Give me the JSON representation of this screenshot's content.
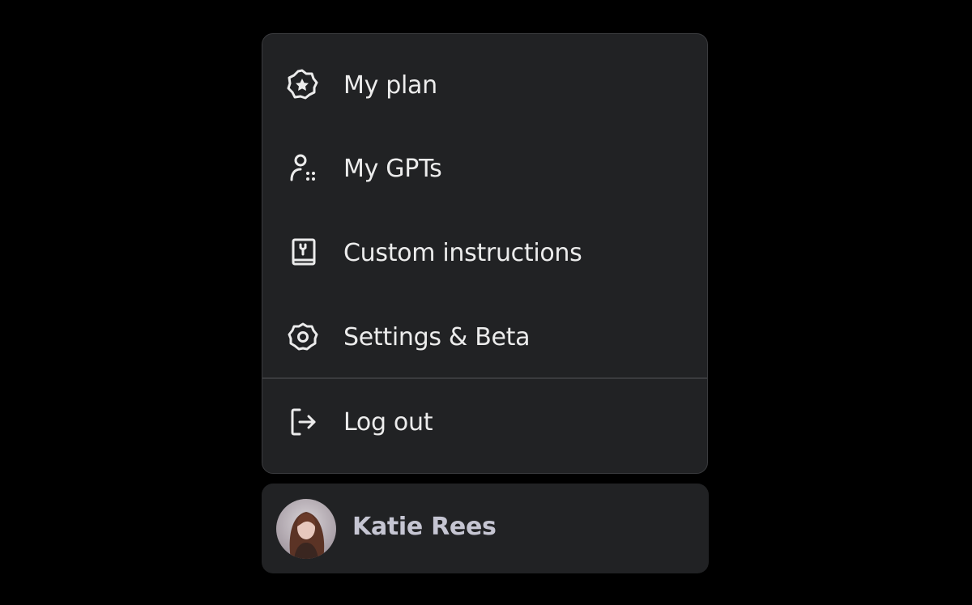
{
  "menu": {
    "items": [
      {
        "label": "My plan",
        "icon": "star-badge-icon"
      },
      {
        "label": "My GPTs",
        "icon": "gpts-user-icon"
      },
      {
        "label": "Custom instructions",
        "icon": "book-instructions-icon"
      },
      {
        "label": "Settings & Beta",
        "icon": "gear-icon"
      }
    ],
    "logout": {
      "label": "Log out",
      "icon": "logout-icon"
    }
  },
  "user": {
    "name": "Katie Rees",
    "avatar": "user-avatar-photo"
  },
  "colors": {
    "background": "#000000",
    "panel": "#212224",
    "border": "#3a3b3e",
    "text": "#ececec",
    "user_name": "#c5c5d2"
  }
}
